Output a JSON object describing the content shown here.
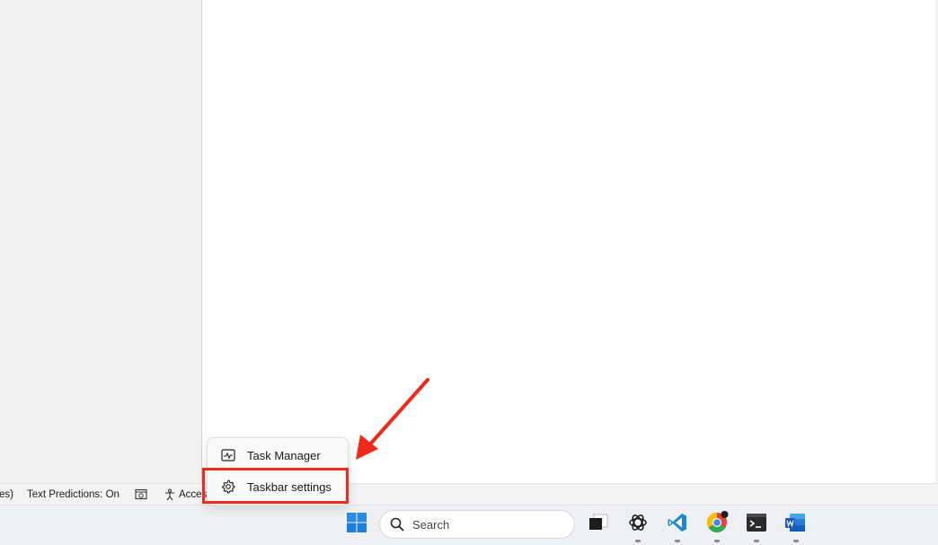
{
  "status_bar": {
    "cut_text": "es)",
    "text_predictions": "Text Predictions: On",
    "accessibility_cut": "Acces"
  },
  "context_menu": {
    "items": [
      {
        "label": "Task Manager",
        "icon": "task-manager-icon"
      },
      {
        "label": "Taskbar settings",
        "icon": "gear-icon"
      }
    ]
  },
  "taskbar": {
    "search_placeholder": "Search",
    "apps": [
      "windows-start-icon",
      "task-view-icon",
      "chatgpt-icon",
      "vscode-icon",
      "chrome-icon",
      "terminal-icon",
      "word-icon"
    ]
  },
  "annotation": {
    "highlight_color": "#ee2a1b",
    "highlights": "Taskbar settings"
  }
}
